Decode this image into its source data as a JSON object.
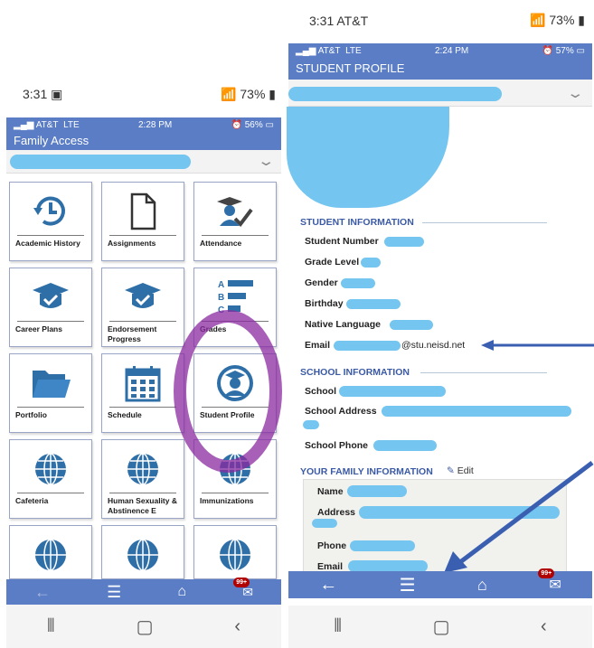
{
  "left_phone": {
    "outer_status": {
      "time": "3:31",
      "battery": "73%"
    },
    "inner_status": {
      "carrier": "AT&T",
      "network": "LTE",
      "time": "2:28 PM",
      "battery": "56%"
    },
    "app_title": "Family Access",
    "tiles": [
      {
        "label": "Academic History",
        "icon": "history-icon"
      },
      {
        "label": "Assignments",
        "icon": "document-icon"
      },
      {
        "label": "Attendance",
        "icon": "graduate-check-icon"
      },
      {
        "label": "Career Plans",
        "icon": "cap-check-icon"
      },
      {
        "label": "Endorsement Progress",
        "icon": "cap-check-icon"
      },
      {
        "label": "Grades",
        "icon": "grades-list-icon"
      },
      {
        "label": "Portfolio",
        "icon": "folder-icon"
      },
      {
        "label": "Schedule",
        "icon": "calendar-icon"
      },
      {
        "label": "Student Profile",
        "icon": "student-avatar-icon"
      },
      {
        "label": "Cafeteria",
        "icon": "globe-icon"
      },
      {
        "label": "Human Sexuality & Abstinence E",
        "icon": "globe-icon"
      },
      {
        "label": "Immunizations",
        "icon": "globe-icon"
      }
    ],
    "badge": "99+"
  },
  "right_phone": {
    "outer_status": {
      "time": "3:31",
      "carrier": "AT&T",
      "battery": "73%"
    },
    "inner_status": {
      "carrier": "AT&T",
      "network": "LTE",
      "time": "2:24 PM",
      "battery": "57%"
    },
    "app_title": "STUDENT PROFILE",
    "student_info": {
      "title": "STUDENT INFORMATION",
      "student_number": "Student Number",
      "grade_level": "Grade Level",
      "gender": "Gender",
      "birthday": "Birthday",
      "native_language": "Native Language",
      "email": "Email",
      "email_domain": "@stu.neisd.net"
    },
    "school_info": {
      "title": "SCHOOL INFORMATION",
      "school": "School",
      "school_address": "School Address",
      "school_phone": "School Phone"
    },
    "family_info": {
      "title": "YOUR FAMILY INFORMATION",
      "edit": "Edit",
      "name": "Name",
      "address": "Address",
      "phone": "Phone",
      "email": "Email"
    },
    "badge": "99+"
  },
  "colors": {
    "header_blue": "#5a7dc6",
    "redact_blue": "#74c5f0",
    "highlight_purple": "#8a2aa0",
    "arrow_blue": "#3a5fb0"
  }
}
